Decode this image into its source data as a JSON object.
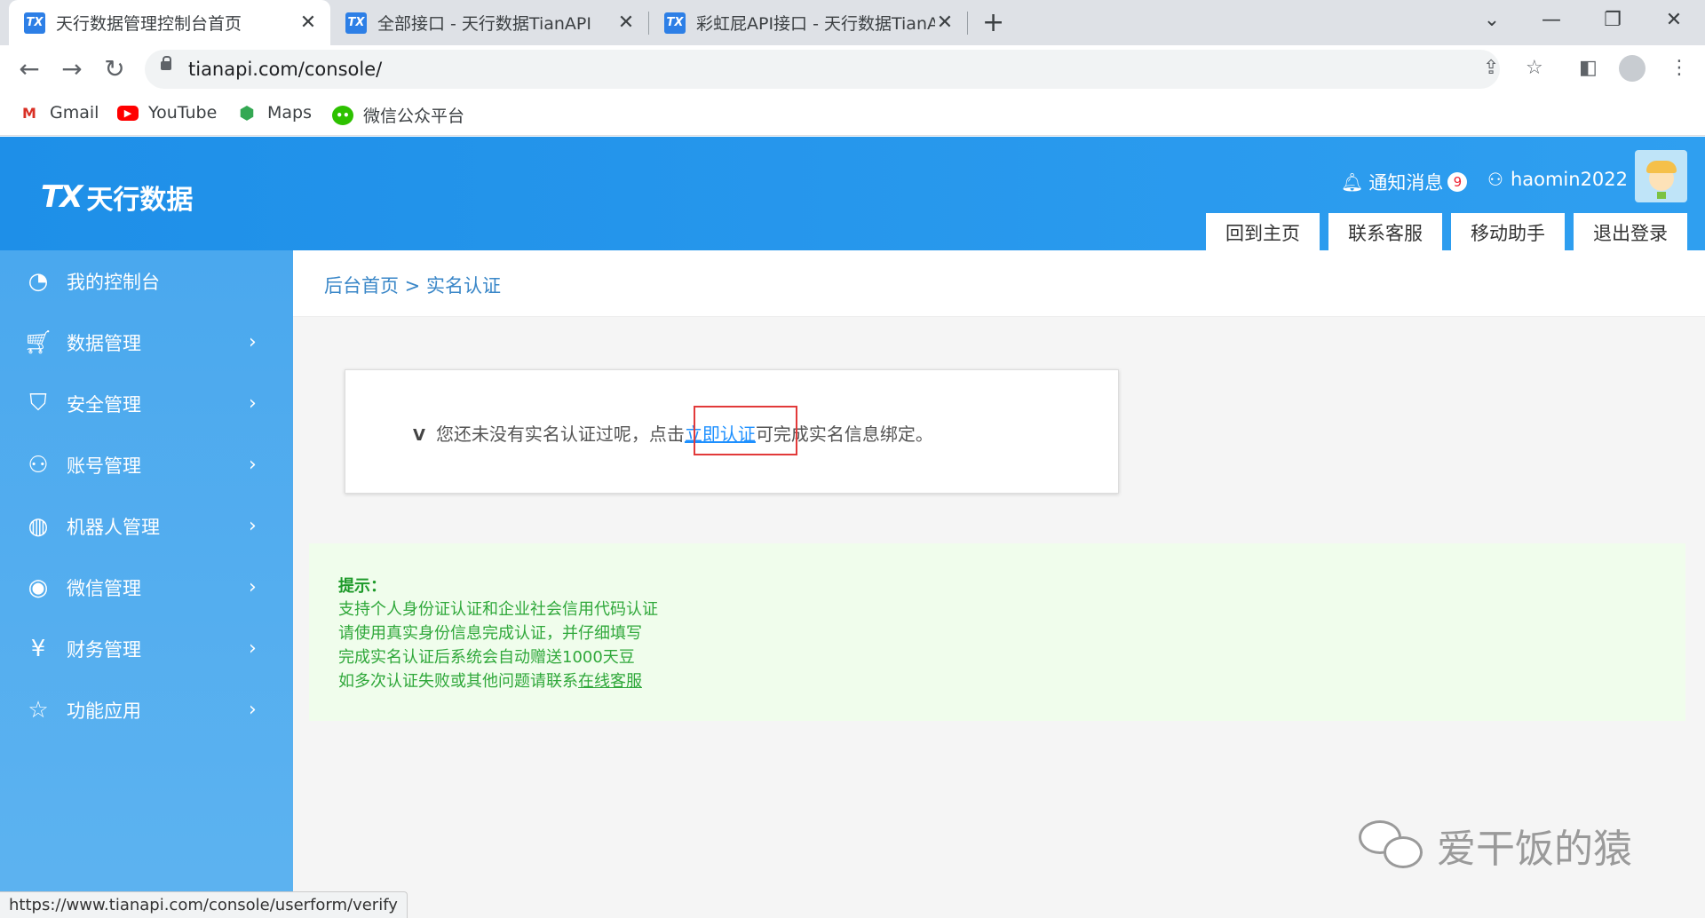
{
  "browser": {
    "tabs": [
      {
        "title": "天行数据管理控制台首页",
        "active": true
      },
      {
        "title": "全部接口 - 天行数据TianAPI",
        "active": false
      },
      {
        "title": "彩虹屁API接口 - 天行数据TianAPI",
        "active": false
      }
    ],
    "favicon_text": "TX",
    "new_tab": "+",
    "url": "tianapi.com/console/",
    "bookmarks": [
      {
        "label": "Gmail",
        "icon": "gmail-icon"
      },
      {
        "label": "YouTube",
        "icon": "youtube-icon"
      },
      {
        "label": "Maps",
        "icon": "maps-icon"
      },
      {
        "label": "微信公众平台",
        "icon": "wechat-icon"
      }
    ]
  },
  "site": {
    "logo_mark": "TX",
    "logo_text": "天行数据",
    "notifications_label": "通知消息",
    "notifications_count": "9",
    "username": "haomin2022",
    "header_tabs": [
      "回到主页",
      "联系客服",
      "移动助手",
      "退出登录"
    ]
  },
  "sidebar": {
    "items": [
      {
        "label": "我的控制台",
        "icon": "dashboard-icon",
        "arrow": ""
      },
      {
        "label": "数据管理",
        "icon": "cart-icon",
        "arrow": "›"
      },
      {
        "label": "安全管理",
        "icon": "shield-icon",
        "arrow": "›"
      },
      {
        "label": "账号管理",
        "icon": "user-icon",
        "arrow": "›"
      },
      {
        "label": "机器人管理",
        "icon": "globe-icon",
        "arrow": "›"
      },
      {
        "label": "微信管理",
        "icon": "earth-icon",
        "arrow": "›"
      },
      {
        "label": "财务管理",
        "icon": "yen-icon",
        "arrow": "›"
      },
      {
        "label": "功能应用",
        "icon": "star-icon",
        "arrow": "›"
      }
    ]
  },
  "main": {
    "breadcrumb": "后台首页 > 实名认证",
    "notice": {
      "mark": "V",
      "before": "您还未没有实名认证过呢，点击",
      "link": "立即认证",
      "after": "可完成实名信息绑定。"
    },
    "tips": {
      "title": "提示：",
      "lines": [
        "支持个人身份证认证和企业社会信用代码认证",
        "请使用真实身份信息完成认证，并仔细填写",
        "完成实名认证后系统会自动赠送1000天豆"
      ],
      "last_line_prefix": "如多次认证失败或其他问题请联系",
      "last_line_link": "在线客服"
    }
  },
  "watermark": "爱干饭的猿",
  "status_url": "https://www.tianapi.com/console/userform/verify"
}
